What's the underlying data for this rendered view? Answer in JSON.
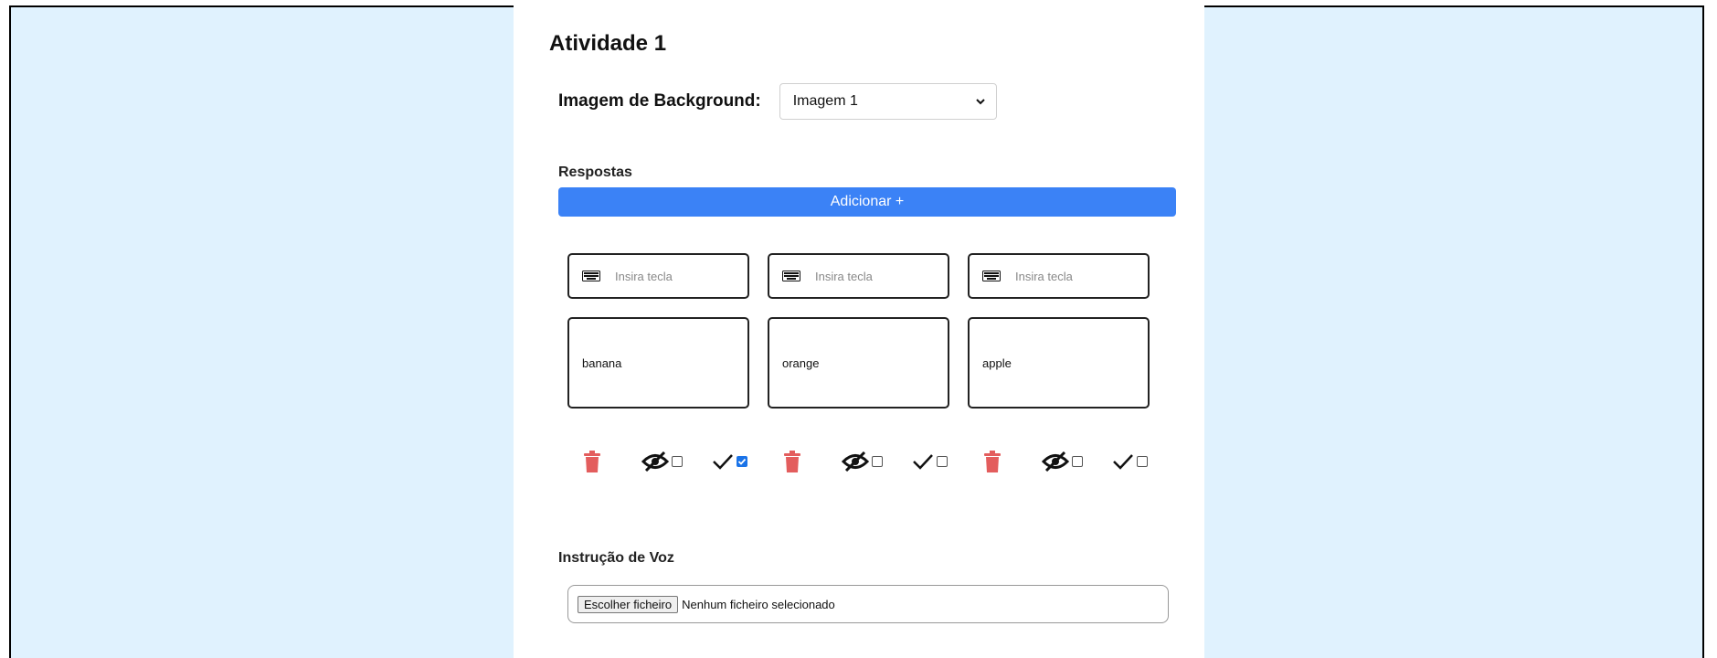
{
  "page": {
    "title": "Atividade 1"
  },
  "background": {
    "label": "Imagem de Background:",
    "selected": "Imagem 1"
  },
  "answers": {
    "label": "Respostas",
    "add_label": "Adicionar +",
    "key_placeholder": "Insira tecla",
    "items": [
      {
        "word": "banana",
        "hidden": false,
        "correct": true
      },
      {
        "word": "orange",
        "hidden": false,
        "correct": false
      },
      {
        "word": "apple",
        "hidden": false,
        "correct": false
      }
    ]
  },
  "voice": {
    "label": "Instrução de Voz",
    "button_label": "Escolher ficheiro",
    "status": "Nenhum ficheiro selecionado"
  },
  "colors": {
    "page_bg": "#e0f2fe",
    "accent": "#3b82f6",
    "delete": "#e35d5d"
  }
}
